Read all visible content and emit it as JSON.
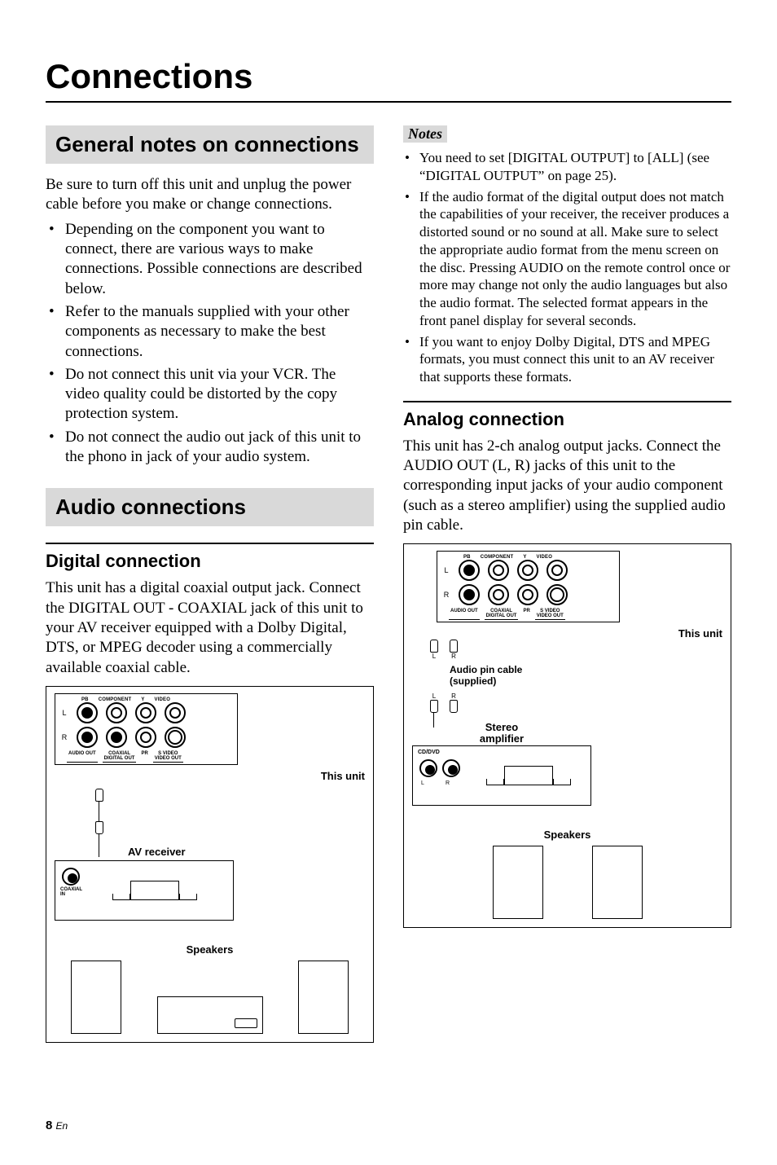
{
  "page": {
    "title": "Connections",
    "footer_page": "8",
    "footer_lang": "En"
  },
  "left": {
    "h2_general": "General notes on connections",
    "general_intro": "Be sure to turn off this unit and unplug the power cable before you make or change connections.",
    "general_bullets": [
      "Depending on the component you want to connect, there are various ways to make connections. Possible connections are described below.",
      "Refer to the manuals supplied with your other components as necessary to make the best connections.",
      "Do not connect this unit via your VCR. The video quality could be distorted by the copy protection system.",
      "Do not connect the audio out jack of this unit to the phono in jack of your audio system."
    ],
    "h2_audio": "Audio connections",
    "h3_digital": "Digital connection",
    "digital_body": "This unit has a digital coaxial output jack. Connect the DIGITAL OUT - COAXIAL jack of this unit to your AV receiver equipped with a Dolby Digital, DTS, or MPEG decoder using a commercially available coaxial cable.",
    "diagram_digital": {
      "this_unit": "This unit",
      "av_receiver": "AV receiver",
      "speakers": "Speakers",
      "coaxial_in": "COAXIAL\nIN",
      "panel_top": {
        "pb": "PB",
        "component": "COMPONENT",
        "y": "Y",
        "video": "VIDEO"
      },
      "panel_bottom": {
        "audio_out": "AUDIO OUT",
        "coaxial": "COAXIAL",
        "digital_out": "DIGITAL OUT",
        "pr": "PR",
        "svideo": "S VIDEO",
        "video_out": "VIDEO OUT"
      }
    }
  },
  "right": {
    "notes_label": "Notes",
    "notes": [
      "You need to set [DIGITAL OUTPUT] to [ALL] (see “DIGITAL OUTPUT” on page 25).",
      "If the audio format of the digital output does not match the capabilities of your receiver, the receiver produces a distorted sound or no sound at all. Make sure to select the appropriate audio format from the menu screen on the disc. Pressing AUDIO on the remote control once or more may change not only the audio languages but also the audio format. The selected format appears in the front panel display for several seconds.",
      "If you want to enjoy Dolby Digital, DTS and MPEG formats, you must connect this unit to an AV receiver that supports these formats."
    ],
    "h3_analog": "Analog connection",
    "analog_body": "This unit has 2-ch analog output jacks. Connect the AUDIO OUT (L, R) jacks of this unit to the corresponding input jacks of your audio component (such as a stereo amplifier) using the supplied audio pin cable.",
    "diagram_analog": {
      "this_unit": "This unit",
      "cable_label": "Audio pin cable\n(supplied)",
      "stereo_amp": "Stereo\namplifier",
      "speakers": "Speakers",
      "cd_dvd": "CD/DVD",
      "panel_top": {
        "pb": "PB",
        "component": "COMPONENT",
        "y": "Y",
        "video": "VIDEO"
      },
      "panel_bottom": {
        "audio_out": "AUDIO OUT",
        "coaxial": "COAXIAL",
        "digital_out": "DIGITAL OUT",
        "pr": "PR",
        "svideo": "S VIDEO",
        "video_out": "VIDEO OUT"
      }
    }
  }
}
